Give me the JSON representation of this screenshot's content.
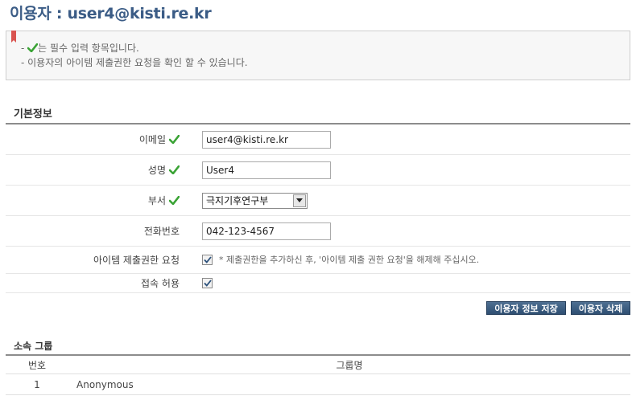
{
  "page": {
    "title": "이용자 : user4@kisti.re.kr"
  },
  "notice": {
    "line1_prefix": "- ",
    "line1_suffix": "는 필수 입력 항목입니다.",
    "line2": "- 이용자의 아이템 제출권한 요청을 확인 할 수 있습니다."
  },
  "basic_info": {
    "title": "기본정보",
    "email": {
      "label": "이메일",
      "value": "user4@kisti.re.kr",
      "required": true
    },
    "name": {
      "label": "성명",
      "value": "User4",
      "required": true
    },
    "department": {
      "label": "부서",
      "selected": "극지기후연구부",
      "required": true
    },
    "phone": {
      "label": "전화번호",
      "value": "042-123-4567"
    },
    "item_permission": {
      "label": "아이템 제출권한 요청",
      "checked": true,
      "hint": "* 제출권한을 추가하신 후, '아이템 제출 권한 요청'을 해제해 주십시오."
    },
    "access": {
      "label": "접속 허용",
      "checked": true
    }
  },
  "buttons": {
    "save": "이용자 정보 저장",
    "delete": "이용자 삭제"
  },
  "groups": {
    "title": "소속 그룹",
    "columns": {
      "number": "번호",
      "name": "그룹명"
    },
    "rows": [
      {
        "number": "1",
        "name": "Anonymous"
      }
    ]
  },
  "colors": {
    "title": "#3b5c86",
    "button": "#3a5a7e",
    "check": "#3aa335"
  },
  "icons": {
    "required": "check-icon",
    "bookmark": "bookmark-icon",
    "dropdown": "chevron-down-icon"
  }
}
